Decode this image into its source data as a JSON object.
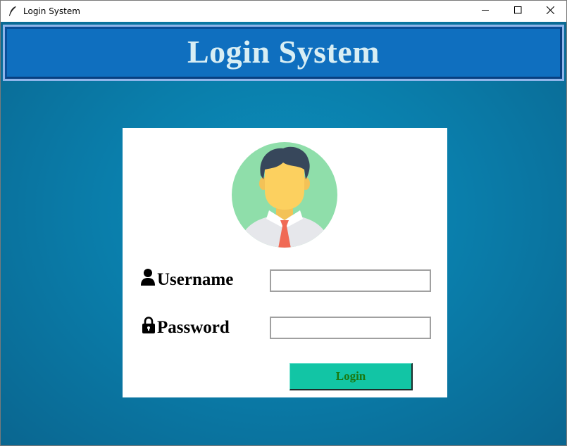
{
  "window": {
    "title": "Login System",
    "icon": "feather-icon",
    "controls": [
      "minimize-icon",
      "maximize-icon",
      "close-icon"
    ]
  },
  "header": {
    "title": "Login System",
    "background_color": "#0f6fbf",
    "text_color": "#d8eef4"
  },
  "form": {
    "avatar": "user-avatar-illustration",
    "username_label": "Username",
    "username_icon": "user-icon",
    "username_value": "",
    "password_label": "Password",
    "password_icon": "lock-icon",
    "password_value": "",
    "login_label": "Login",
    "login_button_color": "#12c5a5",
    "login_text_color": "#1a7a12"
  },
  "colors": {
    "background": "#0a7eab",
    "card": "#ffffff"
  }
}
